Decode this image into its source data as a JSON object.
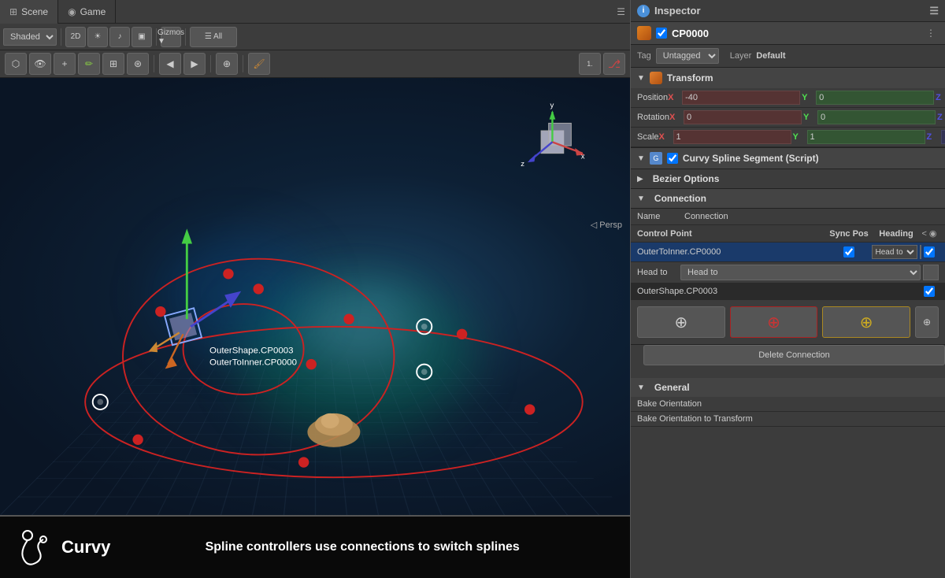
{
  "tabs": {
    "scene": "Scene",
    "game": "Game"
  },
  "toolbar": {
    "shaded_label": "Shaded",
    "mode_label": "2D",
    "gizmos_label": "Gizmos ▼",
    "all_label": "☰ All"
  },
  "tools": {
    "buttons": [
      "⬡",
      "👁",
      "+",
      "✏",
      "⊞",
      "⊛",
      "◀",
      "▶",
      "⊕"
    ]
  },
  "scene": {
    "persp_label": "◁ Persp"
  },
  "inspector": {
    "title": "Inspector",
    "object_name": "CP0000",
    "tag_label": "Tag",
    "tag_value": "Untagged",
    "layer_label": "Layer",
    "layer_value": "Default",
    "transform_title": "Transform",
    "position_label": "Position",
    "position_x": "-40",
    "position_y": "0",
    "position_z": "",
    "rotation_label": "Rotation",
    "rotation_x": "0",
    "rotation_y": "0",
    "rotation_z": "",
    "scale_label": "Scale",
    "scale_x": "1",
    "scale_y": "1",
    "scale_z": "",
    "script_title": "Curvy Spline Segment (Script)",
    "bezier_title": "Bezier Options",
    "connection_title": "Connection",
    "name_label": "Name",
    "name_value": "Connection",
    "cp_col_label": "Control Point",
    "sync_pos_label": "Sync Pos",
    "heading_label": "Heading",
    "cp_row1_name": "OuterToInner.CP0000",
    "cp_row1_checkbox": true,
    "cp_row2_name": "OuterShape.CP0003",
    "cp_row2_checkbox": true,
    "head_to_label": "Head to",
    "delete_connection_label": "Delete Connection",
    "general_title": "General",
    "bake_orientation_label": "Bake Orientation",
    "bake_orientation_transform_label": "Bake Orientation to Transform"
  },
  "bottom": {
    "logo_text": "Curvy",
    "description": "Spline controllers use connections to switch splines"
  }
}
